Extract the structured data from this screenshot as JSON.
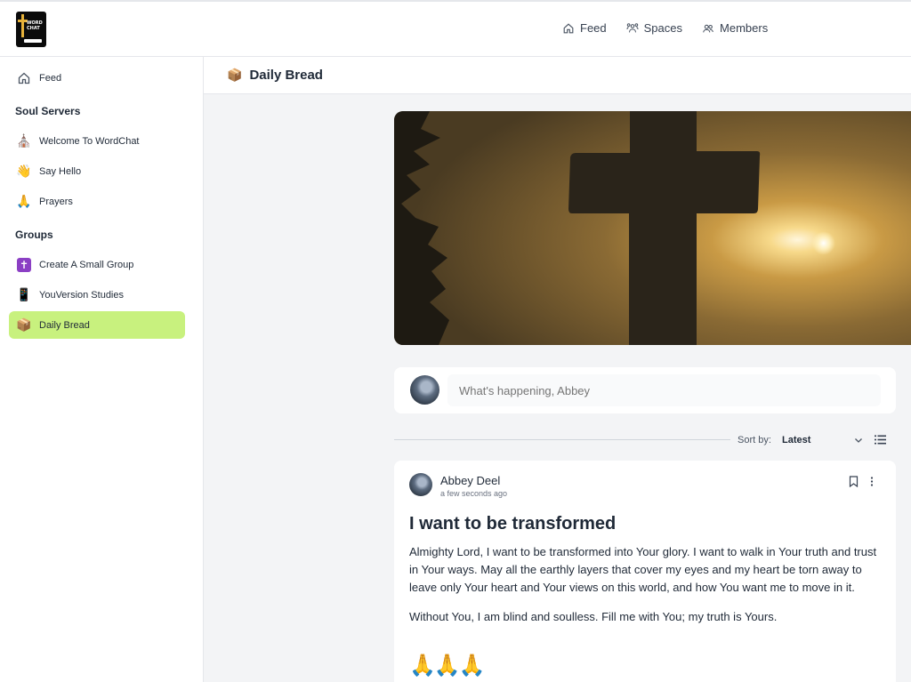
{
  "app": {
    "logo": {
      "text": "WORD CHAT",
      "lines": [
        "WORD",
        "CHAT"
      ]
    }
  },
  "topnav": {
    "items": [
      {
        "label": "Feed",
        "icon": "home-icon"
      },
      {
        "label": "Spaces",
        "icon": "spaces-icon"
      },
      {
        "label": "Members",
        "icon": "members-icon"
      }
    ]
  },
  "sidebar": {
    "feed": {
      "label": "Feed",
      "icon": "home-icon"
    },
    "sections": [
      {
        "heading": "Soul Servers",
        "items": [
          {
            "label": "Welcome To WordChat",
            "icon": "church-emoji",
            "glyph": "⛪"
          },
          {
            "label": "Say Hello",
            "icon": "waving-hand-emoji",
            "glyph": "👋"
          },
          {
            "label": "Prayers",
            "icon": "praying-hands-emoji",
            "glyph": "🙏"
          }
        ]
      },
      {
        "heading": "Groups",
        "items": [
          {
            "label": "Create A Small Group",
            "icon": "latin-cross-emoji",
            "glyph": "✝"
          },
          {
            "label": "YouVersion Studies",
            "icon": "mobile-phone-emoji",
            "glyph": "📱"
          },
          {
            "label": "Daily Bread",
            "icon": "bread-box-emoji",
            "glyph": "📦",
            "active": true
          }
        ]
      }
    ]
  },
  "space": {
    "title": "Daily Bread",
    "icon": "bread-box-emoji",
    "glyph": "📦"
  },
  "composer": {
    "placeholder": "What's happening, Abbey"
  },
  "sort": {
    "label": "Sort by:",
    "value": "Latest"
  },
  "post": {
    "author": "Abbey Deel",
    "time": "a few seconds ago",
    "title": "I want to be transformed",
    "paragraphs": [
      "Almighty Lord, I want to be transformed into Your glory. I want to walk in Your truth and trust in Your ways. May all the earthly layers that cover my eyes and my heart be torn away to leave only Your heart and Your views on this world, and how You want me to move in it.",
      "Without You, I am blind and soulless. Fill me with You; my truth is Yours."
    ],
    "emoji": "🙏🙏🙏"
  },
  "colors": {
    "active_item": "#c8f17e",
    "background": "#f3f4f6",
    "logo_cross": "#e7b23a"
  }
}
